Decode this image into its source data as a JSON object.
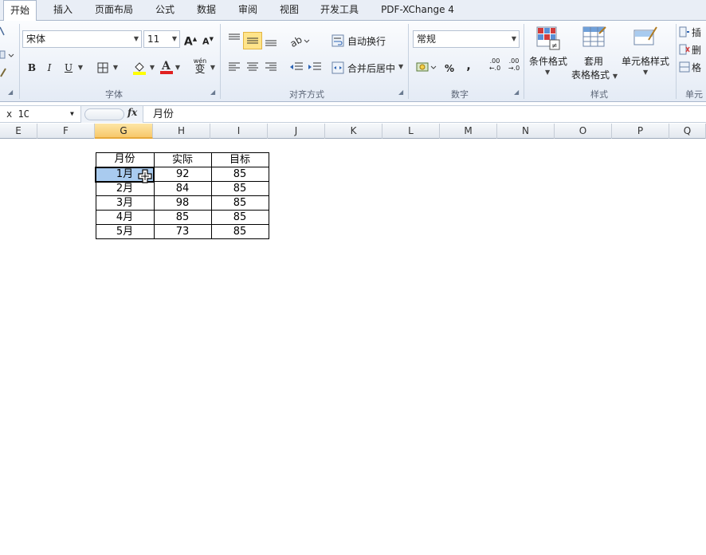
{
  "tabs": [
    {
      "label": "开始",
      "active": true
    },
    {
      "label": "插入",
      "active": false
    },
    {
      "label": "页面布局",
      "active": false
    },
    {
      "label": "公式",
      "active": false
    },
    {
      "label": "数据",
      "active": false
    },
    {
      "label": "审阅",
      "active": false
    },
    {
      "label": "视图",
      "active": false
    },
    {
      "label": "开发工具",
      "active": false
    },
    {
      "label": "PDF-XChange 4",
      "active": false
    }
  ],
  "ribbon": {
    "font": {
      "font_name": "宋体",
      "font_size": "11",
      "bold": "B",
      "italic": "I",
      "underline": "U",
      "grow": "A",
      "shrink": "A",
      "phonetic": "wén",
      "phonetic_char": "变",
      "group_label": "字体"
    },
    "align": {
      "wrap_label": "自动换行",
      "merge_label": "合并后居中",
      "group_label": "对齐方式"
    },
    "number": {
      "format": "常规",
      "percent": "%",
      "comma": ",",
      "inc_decimal": ".00",
      "dec_decimal": ".00",
      "group_label": "数字"
    },
    "styles": {
      "conditional_label": "条件格式",
      "table_label_1": "套用",
      "table_label_2": "表格格式",
      "cell_style_label": "单元格样式",
      "group_label": "样式"
    },
    "cells": {
      "insert_label": "插",
      "delete_label": "删",
      "format_label": "格",
      "group_label": "单元"
    }
  },
  "formula_bar": {
    "name_box": "x 1C",
    "fx": "fx",
    "formula": "月份"
  },
  "columns": [
    "E",
    "F",
    "G",
    "H",
    "I",
    "J",
    "K",
    "L",
    "M",
    "N",
    "O",
    "P",
    "Q"
  ],
  "selected_column": "G",
  "table": {
    "headers": [
      "月份",
      "实际",
      "目标"
    ],
    "rows": [
      [
        "1月",
        "92",
        "85"
      ],
      [
        "2月",
        "84",
        "85"
      ],
      [
        "3月",
        "98",
        "85"
      ],
      [
        "4月",
        "85",
        "85"
      ],
      [
        "5月",
        "73",
        "85"
      ]
    ]
  },
  "colors": {
    "accent": "#f7c86b",
    "selection": "#a9cbef",
    "ribbon_bg": "#e4ebf5"
  }
}
